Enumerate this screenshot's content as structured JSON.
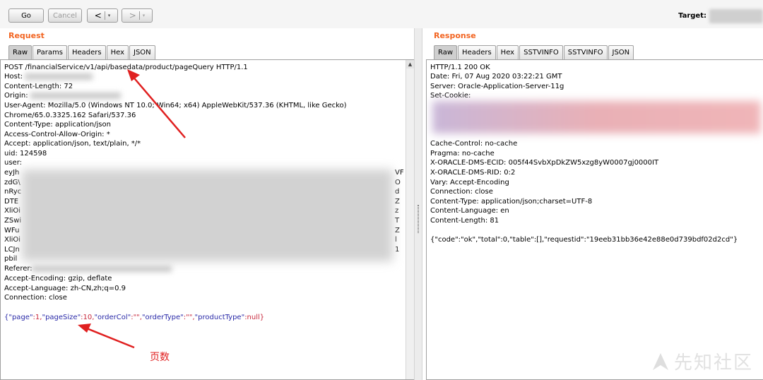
{
  "toolbar": {
    "go_label": "Go",
    "cancel_label": "Cancel",
    "back_label": "<",
    "forward_label": ">",
    "dropdown_glyph": "▾",
    "target_label": "Target:"
  },
  "request": {
    "title": "Request",
    "tabs": [
      "Raw",
      "Params",
      "Headers",
      "Hex",
      "JSON"
    ],
    "active_tab": "Raw",
    "lines": [
      "POST /financialService/v1/api/basedata/product/pageQuery HTTP/1.1",
      "Host:",
      "Content-Length: 72",
      "Origin:",
      "User-Agent: Mozilla/5.0 (Windows NT 10.0; Win64; x64) AppleWebKit/537.36 (KHTML, like Gecko)",
      "Chrome/65.0.3325.162 Safari/537.36",
      "Content-Type: application/json",
      "Access-Control-Allow-Origin: *",
      "Accept: application/json, text/plain, */*",
      "uid: 124598",
      "user:"
    ],
    "token_left": [
      "eyJh",
      "zdG\\",
      "nRyc",
      "DTE",
      "XliOi",
      "ZSwi",
      "WFu",
      "XliOi",
      "LCJn",
      "pbil"
    ],
    "token_right": [
      "VF",
      "O",
      "d",
      "Z",
      "z",
      "T",
      "Z",
      "l",
      "1",
      ""
    ],
    "tail_lines": [
      "Referer:",
      "Accept-Encoding: gzip, deflate",
      "Accept-Language: zh-CN,zh;q=0.9",
      "Connection: close"
    ],
    "body": {
      "k1": "{\"page\"",
      "v1": ":1,",
      "k2": "\"pageSize\"",
      "v2": ":10,",
      "k3": "\"orderCol\"",
      "v3": ":\"\",",
      "k4": "\"orderType\"",
      "v4": ":\"\",",
      "k5": "\"productType\"",
      "v5": ":null}"
    }
  },
  "response": {
    "title": "Response",
    "tabs": [
      "Raw",
      "Headers",
      "Hex",
      "SSTVINFO",
      "SSTVINFO",
      "JSON"
    ],
    "active_tab": "Raw",
    "lines_top": [
      "HTTP/1.1 200 OK",
      "Date: Fri, 07 Aug 2020 03:22:21 GMT",
      "Server: Oracle-Application-Server-11g",
      "Set-Cookie:"
    ],
    "lines_bottom": [
      "Cache-Control: no-cache",
      "Pragma: no-cache",
      "X-ORACLE-DMS-ECID: 005f44SvbXpDkZW5xzg8yW0007gj0000IT",
      "X-ORACLE-DMS-RID: 0:2",
      "Vary: Accept-Encoding",
      "Connection: close",
      "Content-Type: application/json;charset=UTF-8",
      "Content-Language: en",
      "Content-Length: 81"
    ],
    "body": "{\"code\":\"ok\",\"total\":0,\"table\":[],\"requestid\":\"19eeb31bb36e42e88e0d739bdf02d2cd\"}"
  },
  "annotation": {
    "text": "页数",
    "color": "#e02020"
  },
  "watermark": {
    "text": "先知社区"
  },
  "colors": {
    "accent": "#f26522",
    "json_key": "#2a2aa8",
    "json_value": "#c8283c"
  }
}
